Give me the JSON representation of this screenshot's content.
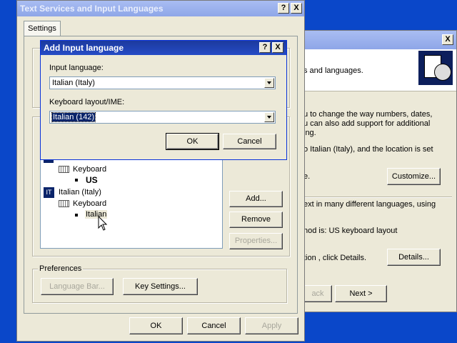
{
  "back_window": {
    "header_text": "s and languages.",
    "paragraph1": "u to change the way numbers, dates,",
    "paragraph2": "u can also add support for additional",
    "paragraph3": "ing.",
    "paragraph4": "o Italian (Italy), and the location is set",
    "paragraph5": "e.",
    "customize_label": "Customize...",
    "paragraph6": "ext in many different languages, using",
    "paragraph7": "hod is: US keyboard layout",
    "paragraph8": "tion , click Details.",
    "details_label": "Details...",
    "back_label": "ack",
    "next_label": "Next >",
    "close_glyph": "X"
  },
  "main_dialog": {
    "title": "Text Services and Input Languages",
    "help_glyph": "?",
    "close_glyph": "X",
    "tab_settings": "Settings",
    "tree": [
      {
        "label": "Keyboard"
      },
      {
        "label": "US"
      },
      {
        "icon_text": "IT",
        "label": "Italian (Italy)"
      },
      {
        "label": "Keyboard"
      },
      {
        "label": "Italian"
      }
    ],
    "add_label": "Add...",
    "remove_label": "Remove",
    "properties_label": "Properties...",
    "preferences_label": "Preferences",
    "language_bar_label": "Language Bar...",
    "key_settings_label": "Key Settings...",
    "ok_label": "OK",
    "cancel_label": "Cancel",
    "apply_label": "Apply"
  },
  "add_dialog": {
    "title": "Add Input language",
    "help_glyph": "?",
    "close_glyph": "X",
    "input_language_label": "Input language:",
    "input_language_value": "Italian (Italy)",
    "keyboard_layout_label": "Keyboard layout/IME:",
    "keyboard_layout_value": "Italian (142)",
    "ok_label": "OK",
    "cancel_label": "Cancel"
  }
}
